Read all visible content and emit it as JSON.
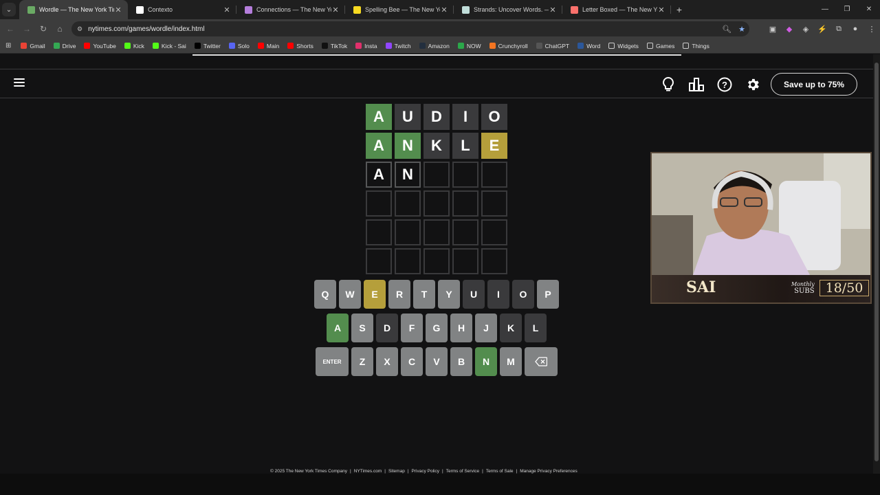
{
  "browser": {
    "tabs": [
      {
        "title": "Wordle — The New York Times",
        "active": true,
        "icon": "wordle-icon",
        "color": "#6aaa64"
      },
      {
        "title": "Contexto",
        "active": false,
        "icon": "contexto-icon",
        "color": "#ffffff"
      },
      {
        "title": "Connections — The New York T",
        "active": false,
        "icon": "connections-icon",
        "color": "#b57edc"
      },
      {
        "title": "Spelling Bee — The New York T",
        "active": false,
        "icon": "spelling-bee-icon",
        "color": "#f7da21"
      },
      {
        "title": "Strands: Uncover Words. — The",
        "active": false,
        "icon": "strands-icon",
        "color": "#c0ddd9"
      },
      {
        "title": "Letter Boxed — The New York T",
        "active": false,
        "icon": "letter-boxed-icon",
        "color": "#fc716c"
      }
    ],
    "url": "nytimes.com/games/wordle/index.html",
    "bookmarks": [
      {
        "label": "Gmail",
        "color": "#ea4335"
      },
      {
        "label": "Drive",
        "color": "#34a853"
      },
      {
        "label": "YouTube",
        "color": "#ff0000"
      },
      {
        "label": "Kick",
        "color": "#53fc18"
      },
      {
        "label": "Kick - Sai",
        "color": "#53fc18"
      },
      {
        "label": "Twitter",
        "color": "#000000"
      },
      {
        "label": "Solo",
        "color": "#5865f2"
      },
      {
        "label": "Main",
        "color": "#ff0000"
      },
      {
        "label": "Shorts",
        "color": "#ff0000"
      },
      {
        "label": "TikTok",
        "color": "#111111"
      },
      {
        "label": "Insta",
        "color": "#e1306c"
      },
      {
        "label": "Twitch",
        "color": "#9146ff"
      },
      {
        "label": "Amazon",
        "color": "#232f3e"
      },
      {
        "label": "NOW",
        "color": "#2ba84a"
      },
      {
        "label": "Crunchyroll",
        "color": "#f47521"
      },
      {
        "label": "ChatGPT",
        "color": "#555555"
      },
      {
        "label": "Word",
        "color": "#2b579a"
      },
      {
        "label": "Widgets",
        "color": "folder"
      },
      {
        "label": "Games",
        "color": "folder"
      },
      {
        "label": "Things",
        "color": "folder"
      }
    ]
  },
  "header": {
    "save_label": "Save up to 75%"
  },
  "board": [
    [
      {
        "l": "A",
        "s": "correct"
      },
      {
        "l": "U",
        "s": "absent"
      },
      {
        "l": "D",
        "s": "absent"
      },
      {
        "l": "I",
        "s": "absent"
      },
      {
        "l": "O",
        "s": "absent"
      }
    ],
    [
      {
        "l": "A",
        "s": "correct"
      },
      {
        "l": "N",
        "s": "correct"
      },
      {
        "l": "K",
        "s": "absent"
      },
      {
        "l": "L",
        "s": "absent"
      },
      {
        "l": "E",
        "s": "present"
      }
    ],
    [
      {
        "l": "A",
        "s": "filled"
      },
      {
        "l": "N",
        "s": "filled"
      },
      {
        "l": "",
        "s": "empty"
      },
      {
        "l": "",
        "s": "empty"
      },
      {
        "l": "",
        "s": "empty"
      }
    ],
    [
      {
        "l": "",
        "s": "empty"
      },
      {
        "l": "",
        "s": "empty"
      },
      {
        "l": "",
        "s": "empty"
      },
      {
        "l": "",
        "s": "empty"
      },
      {
        "l": "",
        "s": "empty"
      }
    ],
    [
      {
        "l": "",
        "s": "empty"
      },
      {
        "l": "",
        "s": "empty"
      },
      {
        "l": "",
        "s": "empty"
      },
      {
        "l": "",
        "s": "empty"
      },
      {
        "l": "",
        "s": "empty"
      }
    ],
    [
      {
        "l": "",
        "s": "empty"
      },
      {
        "l": "",
        "s": "empty"
      },
      {
        "l": "",
        "s": "empty"
      },
      {
        "l": "",
        "s": "empty"
      },
      {
        "l": "",
        "s": "empty"
      }
    ]
  ],
  "keyboard": [
    [
      {
        "k": "Q",
        "s": ""
      },
      {
        "k": "W",
        "s": ""
      },
      {
        "k": "E",
        "s": "present"
      },
      {
        "k": "R",
        "s": ""
      },
      {
        "k": "T",
        "s": ""
      },
      {
        "k": "Y",
        "s": ""
      },
      {
        "k": "U",
        "s": "absent"
      },
      {
        "k": "I",
        "s": "absent"
      },
      {
        "k": "O",
        "s": "absent"
      },
      {
        "k": "P",
        "s": ""
      }
    ],
    [
      {
        "k": "A",
        "s": "correct"
      },
      {
        "k": "S",
        "s": ""
      },
      {
        "k": "D",
        "s": "absent"
      },
      {
        "k": "F",
        "s": ""
      },
      {
        "k": "G",
        "s": ""
      },
      {
        "k": "H",
        "s": ""
      },
      {
        "k": "J",
        "s": ""
      },
      {
        "k": "K",
        "s": "absent"
      },
      {
        "k": "L",
        "s": "absent"
      }
    ],
    [
      {
        "k": "ENTER",
        "s": "",
        "wide": true
      },
      {
        "k": "Z",
        "s": ""
      },
      {
        "k": "X",
        "s": ""
      },
      {
        "k": "C",
        "s": ""
      },
      {
        "k": "V",
        "s": ""
      },
      {
        "k": "B",
        "s": ""
      },
      {
        "k": "N",
        "s": "correct"
      },
      {
        "k": "M",
        "s": ""
      },
      {
        "k": "",
        "s": "",
        "back": true
      }
    ]
  ],
  "footer": [
    "© 2025 The New York Times Company",
    "|",
    "NYTimes.com",
    "|",
    "Sitemap",
    "|",
    "Privacy Policy",
    "|",
    "Terms of Service",
    "|",
    "Terms of Sale",
    "|",
    "Manage Privacy Preferences"
  ],
  "webcam": {
    "name": "SAI",
    "monthly_line1": "Monthly",
    "monthly_line2": "SUBS",
    "count": "18/50"
  },
  "colors": {
    "correct": "#538d4e",
    "present": "#b59f3b",
    "absent": "#3a3a3c",
    "unused_key": "#818384",
    "background": "#121213"
  }
}
